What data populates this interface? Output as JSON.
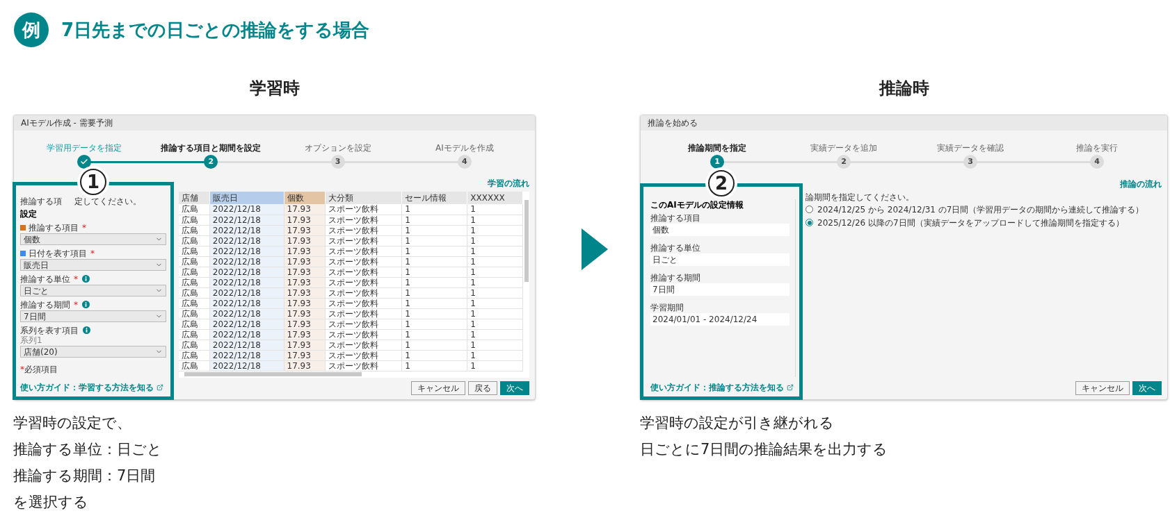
{
  "header": {
    "badge": "例",
    "title": "7日先までの日ごとの推論をする場合"
  },
  "training": {
    "heading": "学習時",
    "window": {
      "title": "AIモデル作成 - 需要予測",
      "steps": [
        {
          "label": "学習用データを指定",
          "completed": true,
          "selected": false
        },
        {
          "label": "推論する項目と期間を設定",
          "number": "2",
          "completed": false,
          "selected": true
        },
        {
          "label": "オプションを設定",
          "number": "3",
          "completed": false,
          "selected": false
        },
        {
          "label": "AIモデルを作成",
          "number": "4",
          "completed": false,
          "selected": false
        }
      ],
      "annotation": "1",
      "sidebar": {
        "instruction_parts": [
          "推論する項",
          "定してください。"
        ],
        "heading": "設定",
        "fields": [
          {
            "label": "推論する項目",
            "color": "#d9731a",
            "required_mark": "*",
            "info": false,
            "value": "個数"
          },
          {
            "label": "日付を表す項目",
            "color": "#3b8ced",
            "required_mark": "*",
            "info": false,
            "value": "販売日"
          },
          {
            "label": "推論する単位",
            "required_mark": "*",
            "info": true,
            "value": "日ごと"
          },
          {
            "label": "推論する期間",
            "required_mark": "*",
            "info": true,
            "value": "7日間"
          },
          {
            "label": "系列を表す項目",
            "info": true,
            "sublabel": "系列1",
            "value": "店舗(20)"
          }
        ],
        "note": {
          "mark": "*",
          "text": "必須項目"
        },
        "guide_link": "使い方ガイド：学習する方法を知る"
      },
      "flow_link": "学習の流れ",
      "table": {
        "columns": [
          {
            "label": "店舗"
          },
          {
            "label": "販売日",
            "color": "#b5cdea"
          },
          {
            "label": "個数",
            "color": "#e3c5a5"
          },
          {
            "label": "大分類"
          },
          {
            "label": "セール情報"
          },
          {
            "label": "XXXXXX"
          }
        ],
        "rows": [
          [
            "広島",
            "2022/12/18",
            "17.93",
            "スポーツ飲料",
            "1",
            "1"
          ],
          [
            "広島",
            "2022/12/18",
            "17.93",
            "スポーツ飲料",
            "1",
            "1"
          ],
          [
            "広島",
            "2022/12/18",
            "17.93",
            "スポーツ飲料",
            "1",
            "1"
          ],
          [
            "広島",
            "2022/12/18",
            "17.93",
            "スポーツ飲料",
            "1",
            "1"
          ],
          [
            "広島",
            "2022/12/18",
            "17.93",
            "スポーツ飲料",
            "1",
            "1"
          ],
          [
            "広島",
            "2022/12/18",
            "17.93",
            "スポーツ飲料",
            "1",
            "1"
          ],
          [
            "広島",
            "2022/12/18",
            "17.93",
            "スポーツ飲料",
            "1",
            "1"
          ],
          [
            "広島",
            "2022/12/18",
            "17.93",
            "スポーツ飲料",
            "1",
            "1"
          ],
          [
            "広島",
            "2022/12/18",
            "17.93",
            "スポーツ飲料",
            "1",
            "1"
          ],
          [
            "広島",
            "2022/12/18",
            "17.93",
            "スポーツ飲料",
            "1",
            "1"
          ],
          [
            "広島",
            "2022/12/18",
            "17.93",
            "スポーツ飲料",
            "1",
            "1"
          ],
          [
            "広島",
            "2022/12/18",
            "17.93",
            "スポーツ飲料",
            "1",
            "1"
          ],
          [
            "広島",
            "2022/12/18",
            "17.93",
            "スポーツ飲料",
            "1",
            "1"
          ],
          [
            "広島",
            "2022/12/18",
            "17.93",
            "スポーツ飲料",
            "1",
            "1"
          ],
          [
            "広島",
            "2022/12/18",
            "17.93",
            "スポーツ飲料",
            "1",
            "1"
          ],
          [
            "広島",
            "2022/12/18",
            "17.93",
            "スポーツ飲料",
            "1",
            "1"
          ]
        ]
      },
      "buttons": [
        {
          "label": "キャンセル",
          "kind": "default"
        },
        {
          "label": "戻る",
          "kind": "default"
        },
        {
          "label": "次へ",
          "kind": "primary"
        }
      ]
    },
    "caption": [
      "学習時の設定で、",
      "推論する単位：日ごと",
      "推論する期間：7日間",
      "を選択する"
    ]
  },
  "inference": {
    "heading": "推論時",
    "window": {
      "title": "推論を始める",
      "steps": [
        {
          "label": "推論期間を指定",
          "number": "1",
          "completed": false,
          "selected": true
        },
        {
          "label": "実績データを追加",
          "number": "2",
          "completed": false,
          "selected": false
        },
        {
          "label": "実績データを確認",
          "number": "3",
          "completed": false,
          "selected": false
        },
        {
          "label": "推論を実行",
          "number": "4",
          "completed": false,
          "selected": false
        }
      ],
      "annotation": "2",
      "sidebar": {
        "heading": "このAIモデルの設定情報",
        "fields": [
          {
            "label": "推論する項目",
            "value": "個数"
          },
          {
            "label": "推論する単位",
            "value": "日ごと"
          },
          {
            "label": "推論する期間",
            "value": "7日間"
          },
          {
            "label": "学習期間",
            "value": "2024/01/01 - 2024/12/24"
          }
        ],
        "guide_link": "使い方ガイド：推論する方法を知る"
      },
      "flow_link": "推論の流れ",
      "instruction": "論期間を指定してください。",
      "options": [
        {
          "label": "2024/12/25 から 2024/12/31 の7日間（学習用データの期間から連続して推論する）",
          "selected": false
        },
        {
          "label": "2025/12/26 以降の7日間（実績データをアップロードして推論期間を指定する）",
          "selected": true
        }
      ],
      "buttons": [
        {
          "label": "キャンセル",
          "kind": "default"
        },
        {
          "label": "次へ",
          "kind": "primary"
        }
      ]
    },
    "caption": [
      "学習時の設定が引き継がれる",
      "日ごとに7日間の推論結果を出力する"
    ]
  }
}
